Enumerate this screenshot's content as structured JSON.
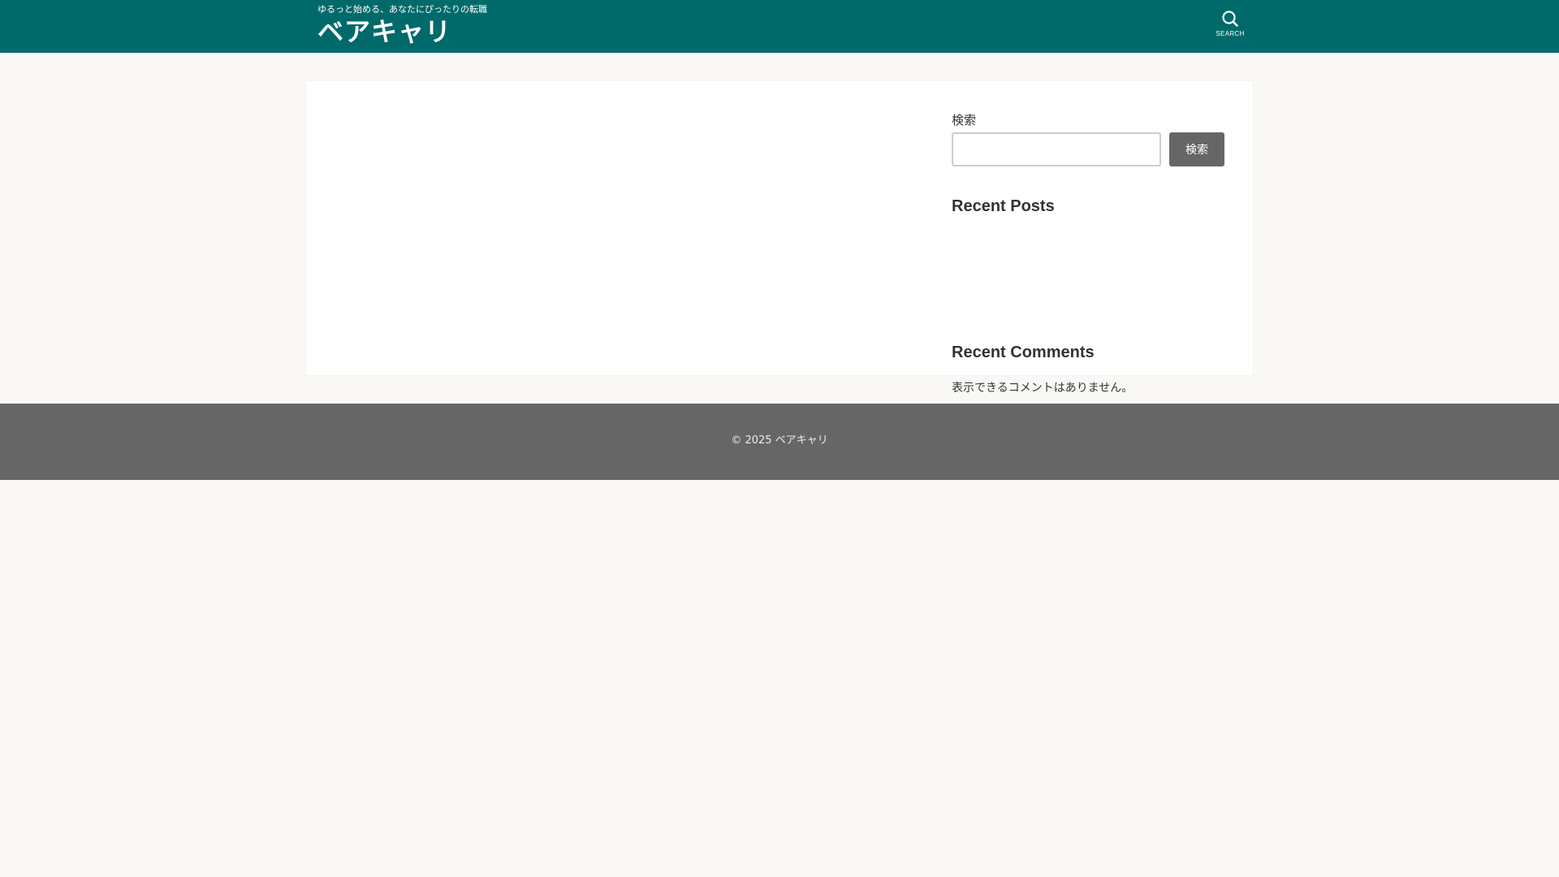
{
  "header": {
    "tagline": "ゆるっと始める、あなたにぴったりの転職",
    "site_title": "ベアキャリ",
    "search_toggle_label": "SEARCH"
  },
  "sidebar": {
    "search": {
      "label": "検索",
      "input_value": "",
      "button_label": "検索"
    },
    "recent_posts": {
      "title": "Recent Posts"
    },
    "recent_comments": {
      "title": "Recent Comments",
      "empty_text": "表示できるコメントはありません。"
    }
  },
  "footer": {
    "copyright_prefix": "© 2025",
    "copyright_link": "ベアキャリ"
  },
  "colors": {
    "header_bg": "#006a6b",
    "page_bg": "#f9f8f5",
    "footer_bg": "#666666",
    "button_bg": "#666666"
  },
  "icons": {
    "search_toggle": "search-icon"
  }
}
